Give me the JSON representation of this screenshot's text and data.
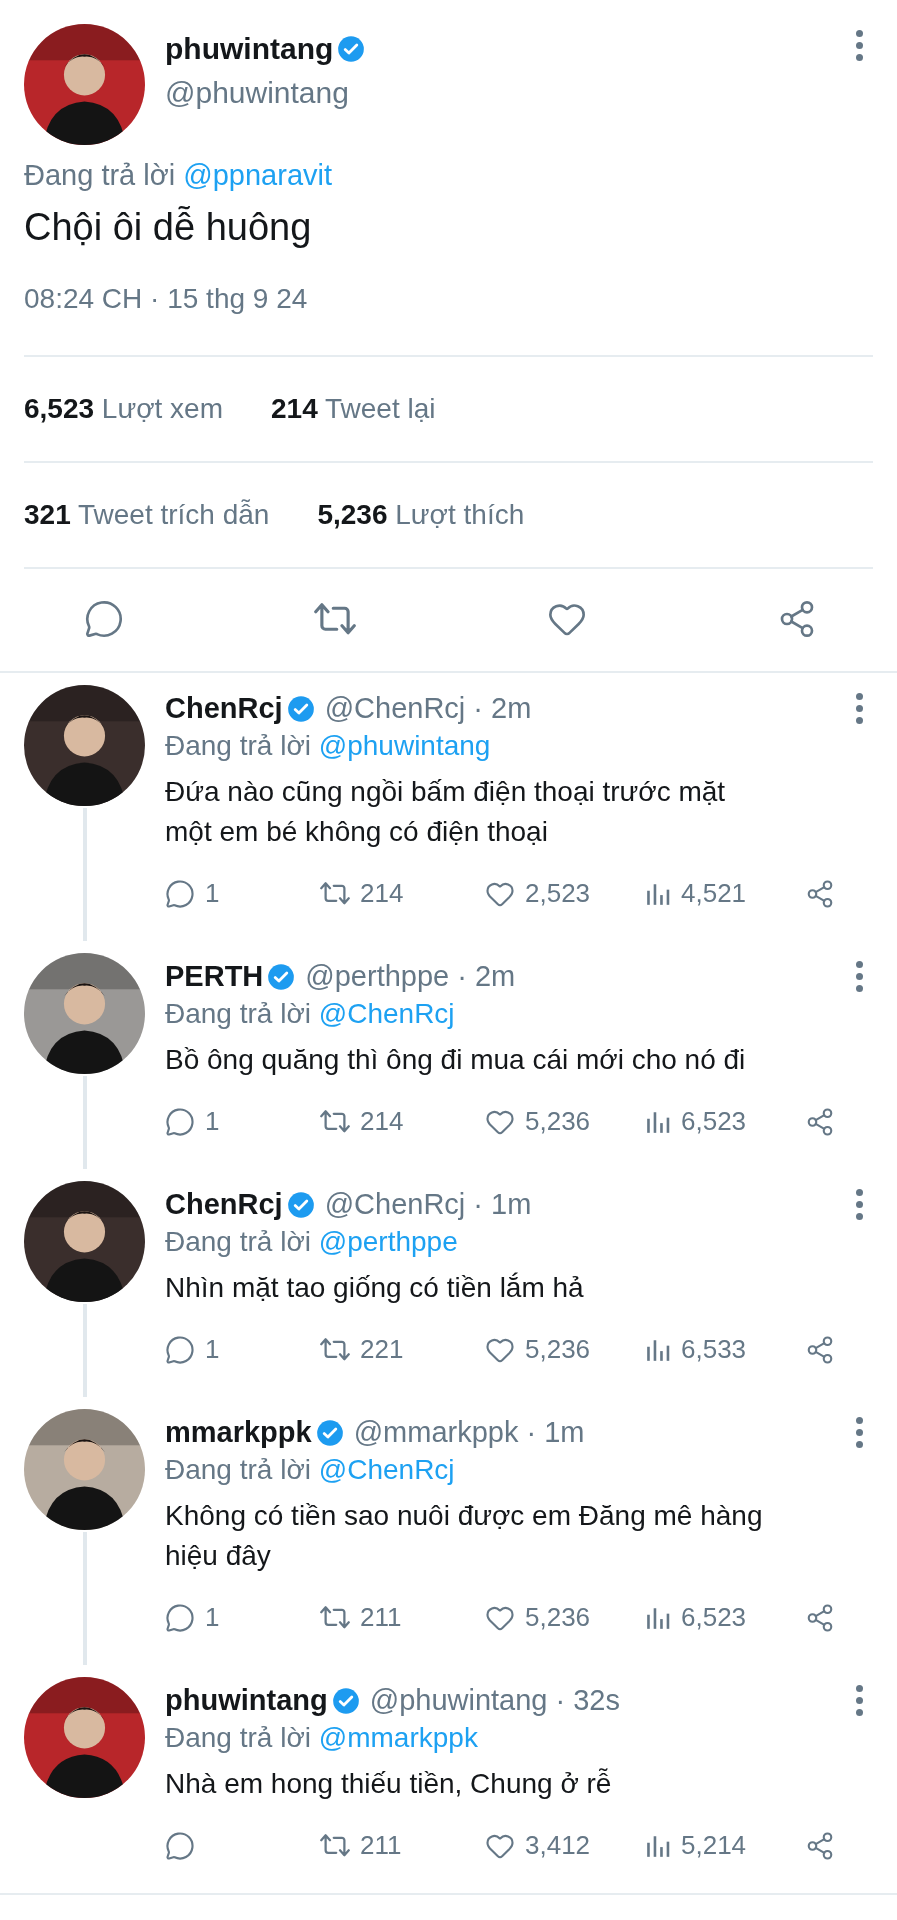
{
  "tweet": {
    "avatar": {
      "color": "#b8262a"
    },
    "name": "phuwintang",
    "verified": true,
    "handle": "@phuwintang",
    "reply_prefix": "Đang trả lời",
    "reply_to": "@ppnaravit",
    "text": "Chội ôi dễ huông",
    "timestamp": "08:24 CH · 15 thg 9 24",
    "stats_rows": [
      [
        "**6,523** Lượt xem",
        "**214** Tweet lại"
      ],
      [
        "**321** Tweet trích dẫn",
        "**5,236** Lượt thích"
      ]
    ]
  },
  "replies": [
    {
      "avatar": {
        "color": "#3a2e2c"
      },
      "name": "ChenRcj",
      "verified": true,
      "meta": "@ChenRcj · 2m",
      "reply_prefix": "Đang trả lời",
      "reply_to": "@phuwintang",
      "text": "Đứa nào cũng ngồi bấm điện thoại trước mặt một em bé không có điện thoại",
      "replies": "1",
      "retweets": "214",
      "likes": "2,523",
      "views": "4,521"
    },
    {
      "avatar": {
        "color": "#9a9896"
      },
      "name": "PERTH",
      "verified": true,
      "meta": "@perthppe · 2m",
      "reply_prefix": "Đang trả lời",
      "reply_to": "@ChenRcj",
      "text": "Bồ ông quăng thì ông đi mua cái mới cho nó đi",
      "replies": "1",
      "retweets": "214",
      "likes": "5,236",
      "views": "6,523"
    },
    {
      "avatar": {
        "color": "#3a2e2c"
      },
      "name": "ChenRcj",
      "verified": true,
      "meta": "@ChenRcj · 1m",
      "reply_prefix": "Đang trả lời",
      "reply_to": "@perthppe",
      "text": "Nhìn mặt tao giống có tiền lắm hả",
      "replies": "1",
      "retweets": "221",
      "likes": "5,236",
      "views": "6,533"
    },
    {
      "avatar": {
        "color": "#b7aca0"
      },
      "name": "mmarkppk",
      "verified": true,
      "meta": "@mmarkppk · 1m",
      "reply_prefix": "Đang trả lời",
      "reply_to": "@ChenRcj",
      "text": "Không có tiền sao nuôi được em Đăng mê hàng hiệu đây",
      "replies": "1",
      "retweets": "211",
      "likes": "5,236",
      "views": "6,523"
    },
    {
      "avatar": {
        "color": "#b8262a"
      },
      "name": "phuwintang",
      "verified": true,
      "meta": "@phuwintang · 32s",
      "reply_prefix": "Đang trả lời",
      "reply_to": "@mmarkppk",
      "text": "Nhà em hong thiếu tiền, Chung ở rễ",
      "retweets": "211",
      "likes": "3,412",
      "views": "5,214"
    }
  ]
}
